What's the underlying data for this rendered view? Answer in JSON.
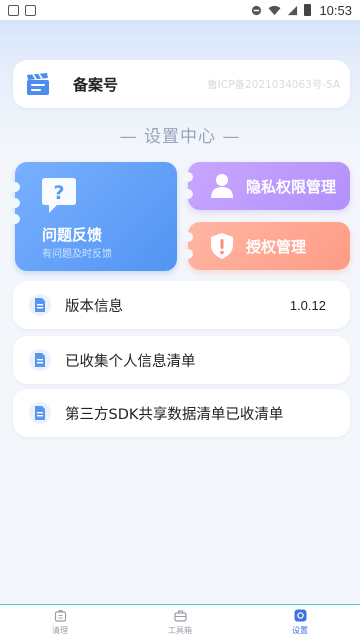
{
  "status_bar": {
    "time": "10:53"
  },
  "record": {
    "label": "备案号",
    "value": "鲁ICP备2021034063号-5A"
  },
  "section": {
    "title": "— 设置中心 —"
  },
  "feedback": {
    "title": "问题反馈",
    "subtitle": "有问题及时反馈"
  },
  "privacy": {
    "label": "隐私权限管理"
  },
  "authorization": {
    "label": "授权管理"
  },
  "list": [
    {
      "label": "版本信息",
      "value": "1.0.12"
    },
    {
      "label": "已收集个人信息清单"
    },
    {
      "label": "第三方SDK共享数据清单已收清单"
    }
  ],
  "tabs": [
    {
      "label": "清理",
      "icon": "broom-icon"
    },
    {
      "label": "工具箱",
      "icon": "toolbox-icon"
    },
    {
      "label": "设置",
      "icon": "settings-icon",
      "active": true
    }
  ],
  "colors": {
    "feedback": "#5c9cf6",
    "privacy": "#bd9cff",
    "authorization": "#ffa591",
    "tab_active": "#3b73e0",
    "tab_border": "#52c7c4"
  }
}
